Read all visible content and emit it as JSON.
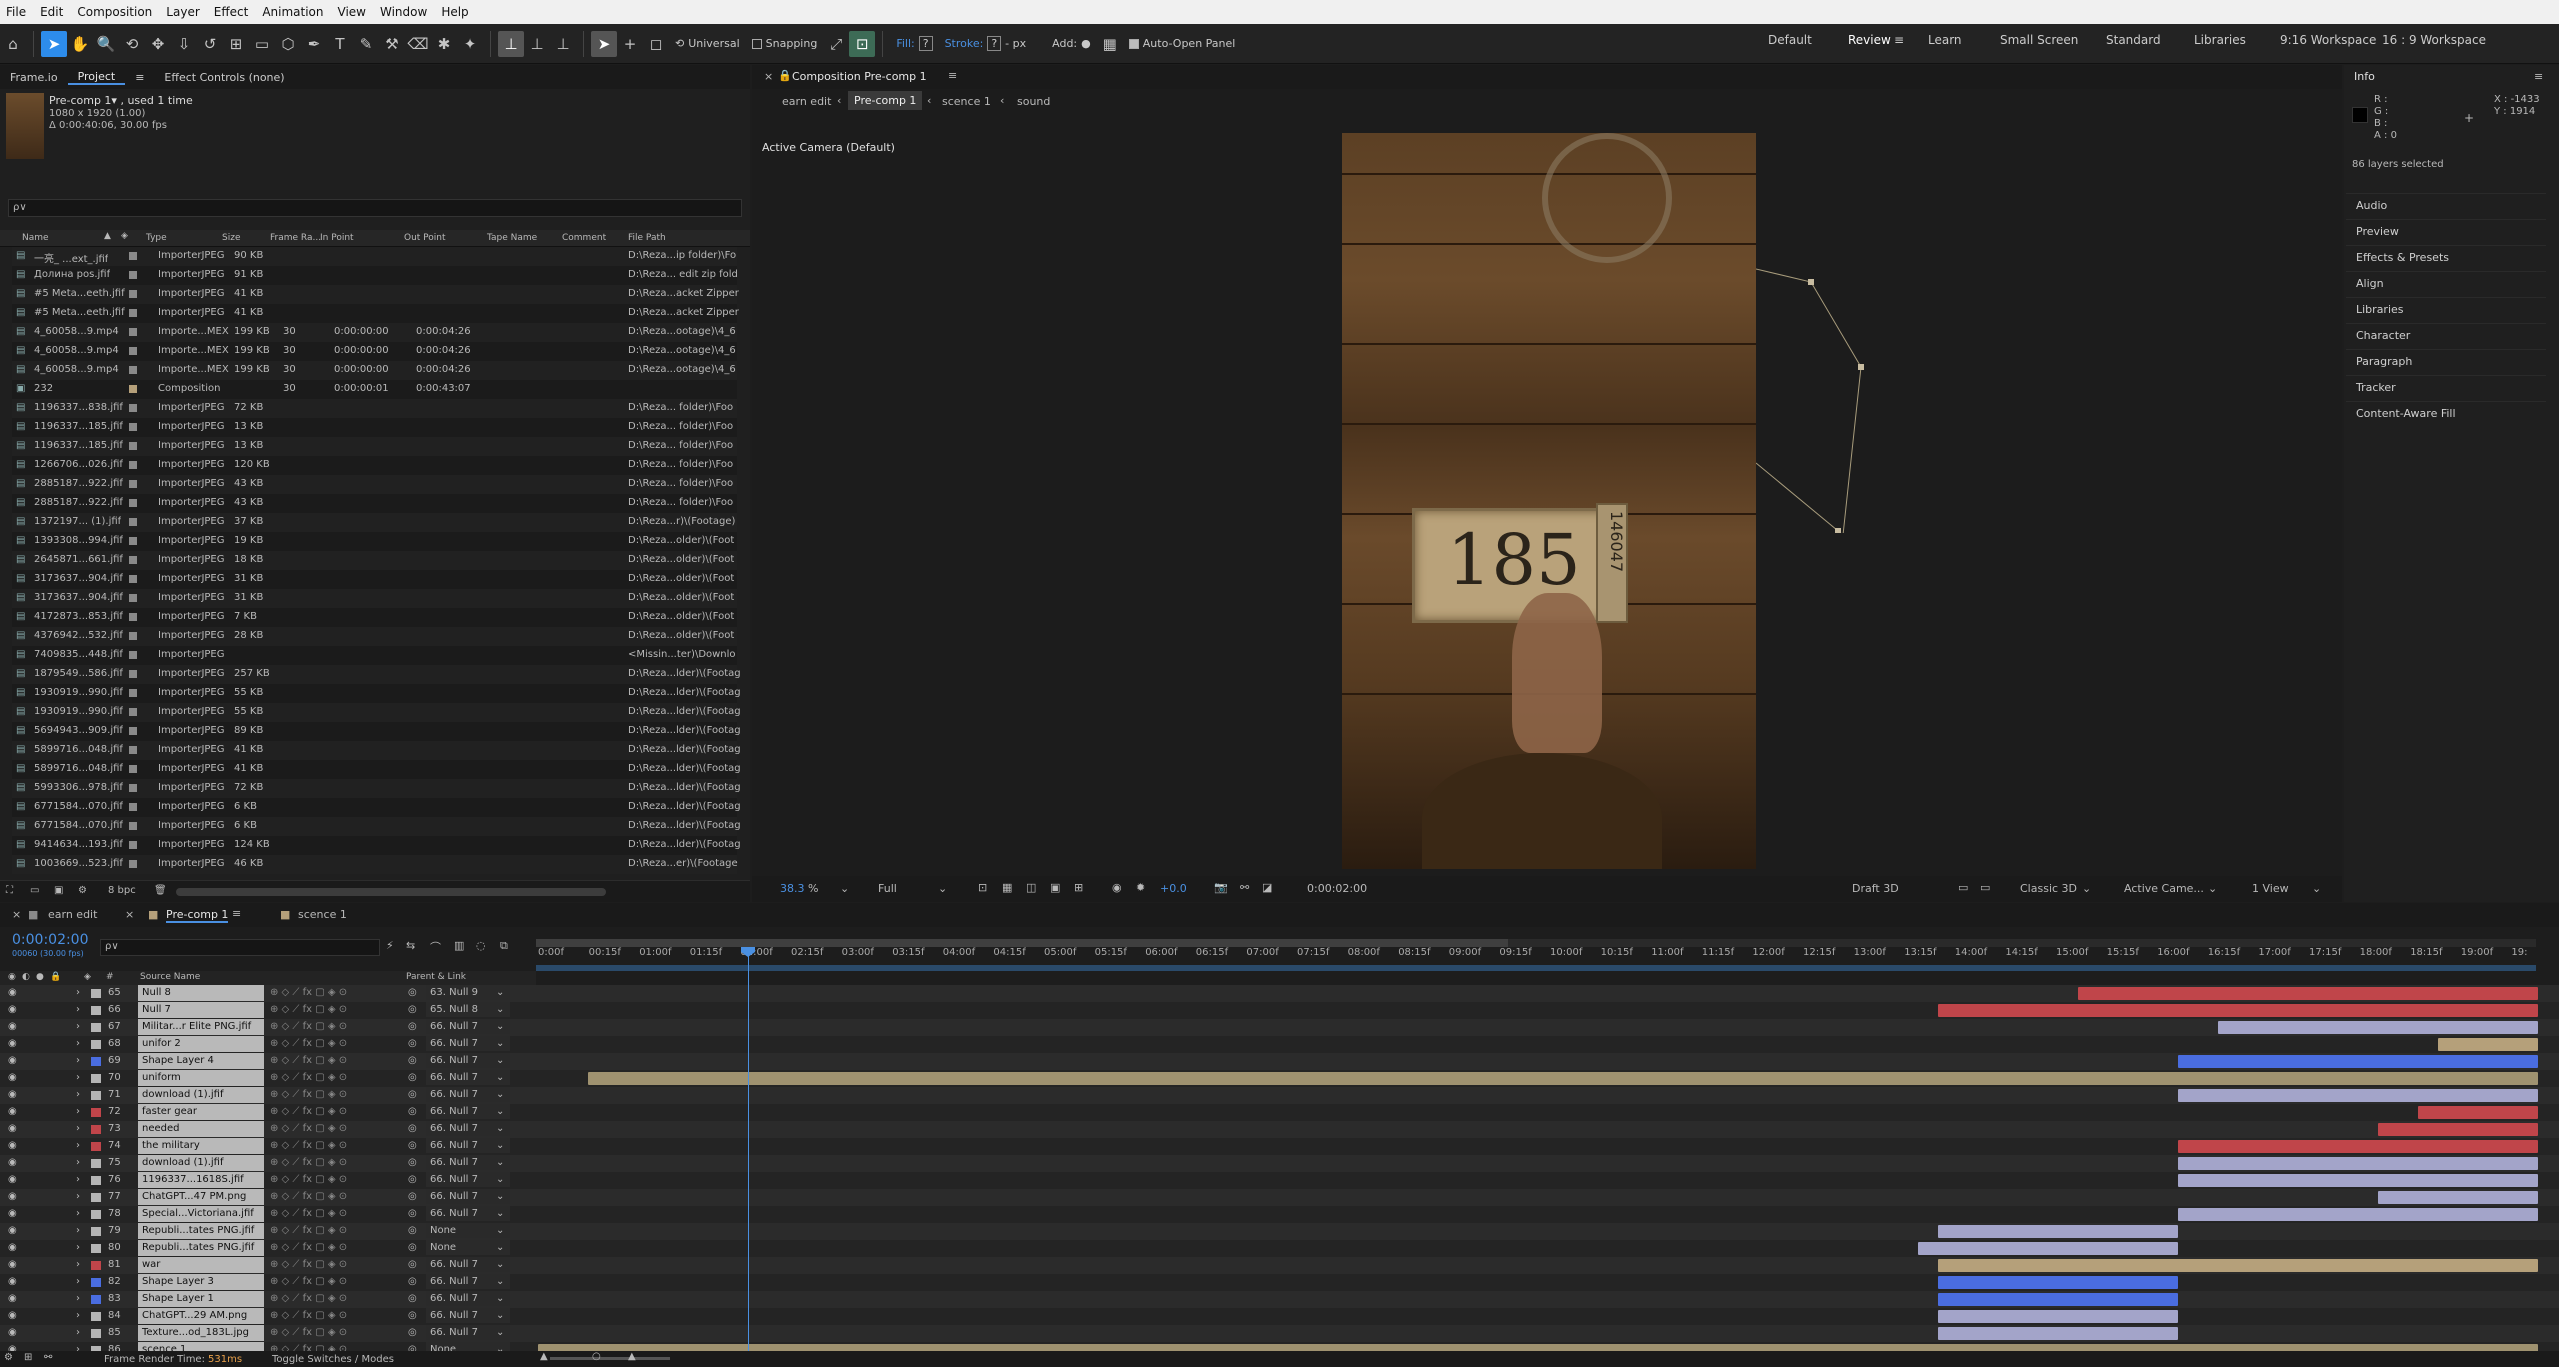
{
  "menu": [
    "File",
    "Edit",
    "Composition",
    "Layer",
    "Effect",
    "Animation",
    "View",
    "Window",
    "Help"
  ],
  "toolbar": {
    "universal": "Universal",
    "snapping": "Snapping",
    "fill": "Fill:",
    "fill_val": "?",
    "stroke": "Stroke:",
    "stroke_val": "?",
    "px": "- px",
    "add": "Add:",
    "auto_open": "Auto-Open Panel"
  },
  "workspaces": [
    "Default",
    "Review",
    "Learn",
    "Small Screen",
    "Standard",
    "Libraries",
    "9:16 Workspace",
    "16 : 9 Workspace"
  ],
  "project": {
    "tabs": [
      "Frame.io",
      "Project",
      "Effect Controls (none)"
    ],
    "comp_name": "Pre-comp 1▾ , used 1 time",
    "comp_res": "1080 x 1920 (1.00)",
    "comp_dur": "Δ 0:00:40:06, 30.00 fps",
    "search_placeholder": "ρ∨",
    "columns": [
      "Name",
      "Type",
      "Size",
      "Frame Ra...",
      "In Point",
      "Out Point",
      "Tape Name",
      "Comment",
      "File Path"
    ],
    "rows": [
      [
        "一亮_ ...ext_.jfif",
        "ImporterJPEG",
        "90 KB",
        "",
        "",
        "",
        "D:\\Reza...ip folder)\\Fo"
      ],
      [
        "Долина pos.jfif",
        "ImporterJPEG",
        "91 KB",
        "",
        "",
        "",
        "D:\\Reza... edit zip fold"
      ],
      [
        "#5 Meta...eeth.jfif",
        "ImporterJPEG",
        "41 KB",
        "",
        "",
        "",
        "D:\\Reza...acket Zipper"
      ],
      [
        "#5 Meta...eeth.jfif",
        "ImporterJPEG",
        "41 KB",
        "",
        "",
        "",
        "D:\\Reza...acket Zipper"
      ],
      [
        "4_60058...9.mp4",
        "Importe...MEX",
        "199 KB",
        "30",
        "0:00:00:00",
        "0:00:04:26",
        "D:\\Reza...ootage)\\4_6"
      ],
      [
        "4_60058...9.mp4",
        "Importe...MEX",
        "199 KB",
        "30",
        "0:00:00:00",
        "0:00:04:26",
        "D:\\Reza...ootage)\\4_6"
      ],
      [
        "4_60058...9.mp4",
        "Importe...MEX",
        "199 KB",
        "30",
        "0:00:00:00",
        "0:00:04:26",
        "D:\\Reza...ootage)\\4_6"
      ],
      [
        "232",
        "Composition",
        "",
        "30",
        "0:00:00:01",
        "0:00:43:07",
        ""
      ],
      [
        "1196337...838.jfif",
        "ImporterJPEG",
        "72 KB",
        "",
        "",
        "",
        "D:\\Reza... folder)\\Foo"
      ],
      [
        "1196337...185.jfif",
        "ImporterJPEG",
        "13 KB",
        "",
        "",
        "",
        "D:\\Reza... folder)\\Foo"
      ],
      [
        "1196337...185.jfif",
        "ImporterJPEG",
        "13 KB",
        "",
        "",
        "",
        "D:\\Reza... folder)\\Foo"
      ],
      [
        "1266706...026.jfif",
        "ImporterJPEG",
        "120 KB",
        "",
        "",
        "",
        "D:\\Reza... folder)\\Foo"
      ],
      [
        "2885187...922.jfif",
        "ImporterJPEG",
        "43 KB",
        "",
        "",
        "",
        "D:\\Reza... folder)\\Foo"
      ],
      [
        "2885187...922.jfif",
        "ImporterJPEG",
        "43 KB",
        "",
        "",
        "",
        "D:\\Reza... folder)\\Foo"
      ],
      [
        "1372197... (1).jfif",
        "ImporterJPEG",
        "37 KB",
        "",
        "",
        "",
        "D:\\Reza...r)\\(Footage)"
      ],
      [
        "1393308...994.jfif",
        "ImporterJPEG",
        "19 KB",
        "",
        "",
        "",
        "D:\\Reza...older)\\(Foot"
      ],
      [
        "2645871...661.jfif",
        "ImporterJPEG",
        "18 KB",
        "",
        "",
        "",
        "D:\\Reza...older)\\(Foot"
      ],
      [
        "3173637...904.jfif",
        "ImporterJPEG",
        "31 KB",
        "",
        "",
        "",
        "D:\\Reza...older)\\(Foot"
      ],
      [
        "3173637...904.jfif",
        "ImporterJPEG",
        "31 KB",
        "",
        "",
        "",
        "D:\\Reza...older)\\(Foot"
      ],
      [
        "4172873...853.jfif",
        "ImporterJPEG",
        "7 KB",
        "",
        "",
        "",
        "D:\\Reza...older)\\(Foot"
      ],
      [
        "4376942...532.jfif",
        "ImporterJPEG",
        "28 KB",
        "",
        "",
        "",
        "D:\\Reza...older)\\(Foot"
      ],
      [
        "7409835...448.jfif",
        "ImporterJPEG",
        "",
        "",
        "",
        "",
        "<Missin...ter)\\Downlo"
      ],
      [
        "1879549...586.jfif",
        "ImporterJPEG",
        "257 KB",
        "",
        "",
        "",
        "D:\\Reza...lder)\\(Footag"
      ],
      [
        "1930919...990.jfif",
        "ImporterJPEG",
        "55 KB",
        "",
        "",
        "",
        "D:\\Reza...lder)\\(Footag"
      ],
      [
        "1930919...990.jfif",
        "ImporterJPEG",
        "55 KB",
        "",
        "",
        "",
        "D:\\Reza...lder)\\(Footag"
      ],
      [
        "5694943...909.jfif",
        "ImporterJPEG",
        "89 KB",
        "",
        "",
        "",
        "D:\\Reza...lder)\\(Footag"
      ],
      [
        "5899716...048.jfif",
        "ImporterJPEG",
        "41 KB",
        "",
        "",
        "",
        "D:\\Reza...lder)\\(Footag"
      ],
      [
        "5899716...048.jfif",
        "ImporterJPEG",
        "41 KB",
        "",
        "",
        "",
        "D:\\Reza...lder)\\(Footag"
      ],
      [
        "5993306...978.jfif",
        "ImporterJPEG",
        "72 KB",
        "",
        "",
        "",
        "D:\\Reza...lder)\\(Footag"
      ],
      [
        "6771584...070.jfif",
        "ImporterJPEG",
        "6 KB",
        "",
        "",
        "",
        "D:\\Reza...lder)\\(Footag"
      ],
      [
        "6771584...070.jfif",
        "ImporterJPEG",
        "6 KB",
        "",
        "",
        "",
        "D:\\Reza...lder)\\(Footag"
      ],
      [
        "9414634...193.jfif",
        "ImporterJPEG",
        "124 KB",
        "",
        "",
        "",
        "D:\\Reza...lder)\\(Footag"
      ],
      [
        "1003669...523.jfif",
        "ImporterJPEG",
        "46 KB",
        "",
        "",
        "",
        "D:\\Reza...er)\\(Footage"
      ]
    ],
    "bpc": "8 bpc"
  },
  "comp": {
    "title": "Composition Pre-comp 1",
    "crumbs": [
      "earn edit",
      "Pre-comp 1",
      "scence 1",
      "sound"
    ],
    "camera": "Active Camera (Default)",
    "footer": {
      "zoom": "38.3",
      "pct": "%",
      "res": "Full",
      "offset": "+0.0",
      "time": "0:00:02:00",
      "draft": "Draft 3D",
      "renderer": "Classic 3D",
      "cam": "Active Came...",
      "view": "1 View"
    },
    "plate": "185",
    "plate_side": "146047"
  },
  "info": {
    "title": "Info",
    "r": "R :",
    "g": "G :",
    "b": "B :",
    "a": "A : 0",
    "x": "X : -1433",
    "y": "Y : 1914",
    "selected": "86 layers selected"
  },
  "right_panels": [
    "Audio",
    "Preview",
    "Effects & Presets",
    "Align",
    "Libraries",
    "Character",
    "Paragraph",
    "Tracker",
    "Content-Aware Fill"
  ],
  "timeline": {
    "tabs": [
      "earn edit",
      "Pre-comp 1",
      "scence 1"
    ],
    "time": "0:00:02:00",
    "frames": "00060 (30.00 fps)",
    "cols": {
      "num": "#",
      "src": "Source Name",
      "parent": "Parent & Link"
    },
    "ruler": [
      "0:00f",
      "00:15f",
      "01:00f",
      "01:15f",
      "02:00f",
      "02:15f",
      "03:00f",
      "03:15f",
      "04:00f",
      "04:15f",
      "05:00f",
      "05:15f",
      "06:00f",
      "06:15f",
      "07:00f",
      "07:15f",
      "08:00f",
      "08:15f",
      "09:00f",
      "09:15f",
      "10:00f",
      "10:15f",
      "11:00f",
      "11:15f",
      "12:00f",
      "12:15f",
      "13:00f",
      "13:15f",
      "14:00f",
      "14:15f",
      "15:00f",
      "15:15f",
      "16:00f",
      "16:15f",
      "17:00f",
      "17:15f",
      "18:00f",
      "18:15f",
      "19:00f",
      "19:"
    ],
    "layers": [
      {
        "n": "65",
        "name": "Null 8",
        "parent": "63. Null 9",
        "lc": "#b5b5b5",
        "start": 0.77,
        "end": 1.0,
        "col": "#c0454a"
      },
      {
        "n": "66",
        "name": "Null 7",
        "parent": "65. Null 8",
        "lc": "#b5b5b5",
        "start": 0.7,
        "end": 1.0,
        "col": "#c0454a"
      },
      {
        "n": "67",
        "name": "Militar...r Elite PNG.jfif",
        "parent": "66. Null 7",
        "lc": "#b5b5b5",
        "start": 0.84,
        "end": 1.0,
        "col": "#a3a4c9"
      },
      {
        "n": "68",
        "name": "unifor 2",
        "parent": "66. Null 7",
        "lc": "#b5b5b5",
        "start": 0.95,
        "end": 1.0,
        "col": "#b5a07a"
      },
      {
        "n": "69",
        "name": "Shape Layer 4",
        "parent": "66. Null 7",
        "lc": "#4a6de0",
        "start": 0.82,
        "end": 1.0,
        "col": "#4a6de0"
      },
      {
        "n": "70",
        "name": "uniform",
        "parent": "66. Null 7",
        "lc": "#b5b5b5",
        "start": 0.025,
        "end": 1.0,
        "col": "#9f9270"
      },
      {
        "n": "71",
        "name": "download (1).jfif",
        "parent": "66. Null 7",
        "lc": "#b5b5b5",
        "start": 0.82,
        "end": 1.0,
        "col": "#a3a4c9"
      },
      {
        "n": "72",
        "name": "faster gear",
        "parent": "66. Null 7",
        "lc": "#c0454a",
        "start": 0.94,
        "end": 1.0,
        "col": "#c0454a"
      },
      {
        "n": "73",
        "name": "needed",
        "parent": "66. Null 7",
        "lc": "#c0454a",
        "start": 0.92,
        "end": 1.0,
        "col": "#c0454a"
      },
      {
        "n": "74",
        "name": "the military",
        "parent": "66. Null 7",
        "lc": "#c0454a",
        "start": 0.82,
        "end": 1.0,
        "col": "#c0454a"
      },
      {
        "n": "75",
        "name": "download (1).jfif",
        "parent": "66. Null 7",
        "lc": "#b5b5b5",
        "start": 0.82,
        "end": 1.0,
        "col": "#a3a4c9"
      },
      {
        "n": "76",
        "name": "1196337...1618S.jfif",
        "parent": "66. Null 7",
        "lc": "#b5b5b5",
        "start": 0.82,
        "end": 1.0,
        "col": "#a3a4c9"
      },
      {
        "n": "77",
        "name": "ChatGPT...47 PM.png",
        "parent": "66. Null 7",
        "lc": "#b5b5b5",
        "start": 0.92,
        "end": 1.0,
        "col": "#a3a4c9"
      },
      {
        "n": "78",
        "name": "Special...Victoriana.jfif",
        "parent": "66. Null 7",
        "lc": "#b5b5b5",
        "start": 0.82,
        "end": 1.0,
        "col": "#a3a4c9"
      },
      {
        "n": "79",
        "name": "Republi...tates PNG.jfif",
        "parent": "None",
        "lc": "#b5b5b5",
        "start": 0.7,
        "end": 0.82,
        "col": "#a3a4c9"
      },
      {
        "n": "80",
        "name": "Republi...tates PNG.jfif",
        "parent": "None",
        "lc": "#b5b5b5",
        "start": 0.69,
        "end": 0.82,
        "col": "#a3a4c9"
      },
      {
        "n": "81",
        "name": "war",
        "parent": "66. Null 7",
        "lc": "#c0454a",
        "start": 0.7,
        "end": 1.0,
        "col": "#b5a07a"
      },
      {
        "n": "82",
        "name": "Shape Layer 3",
        "parent": "66. Null 7",
        "lc": "#4a6de0",
        "start": 0.7,
        "end": 0.82,
        "col": "#4a6de0"
      },
      {
        "n": "83",
        "name": "Shape Layer 1",
        "parent": "66. Null 7",
        "lc": "#4a6de0",
        "start": 0.7,
        "end": 0.82,
        "col": "#4a6de0"
      },
      {
        "n": "84",
        "name": "ChatGPT...29 AM.png",
        "parent": "66. Null 7",
        "lc": "#b5b5b5",
        "start": 0.7,
        "end": 0.82,
        "col": "#a3a4c9"
      },
      {
        "n": "85",
        "name": "Texture...od_183L.jpg",
        "parent": "66. Null 7",
        "lc": "#b5b5b5",
        "start": 0.7,
        "end": 0.82,
        "col": "#a3a4c9"
      },
      {
        "n": "86",
        "name": "scence 1",
        "parent": "None",
        "lc": "#b5b5b5",
        "start": 0.0,
        "end": 1.0,
        "col": "#9f9270"
      }
    ],
    "footer": {
      "render_label": "Frame Render Time:",
      "render_val": "531ms",
      "toggle": "Toggle Switches / Modes"
    }
  }
}
